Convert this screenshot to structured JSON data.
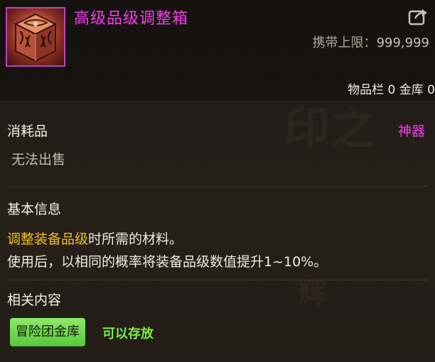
{
  "item": {
    "name": "高级品级调整箱",
    "carry_limit_label": "携带上限：",
    "carry_limit_value": "999,999",
    "storage_text": "物品栏 0 金库 0",
    "category": "消耗品",
    "rarity": "神器",
    "sell_status": "无法出售"
  },
  "basic_info": {
    "title": "基本信息",
    "line1_highlight": "调整装备品级",
    "line1_rest": "时所需的材料。",
    "line2": "使用后，以相同的概率将装备品级数值提升1~10%。"
  },
  "related": {
    "title": "相关内容",
    "tag_label": "冒险团金库",
    "tag_note": "可以存放"
  },
  "colors": {
    "rarity": "#f040e8",
    "highlight": "#f0c020",
    "tag_bg": "#6ad84a",
    "tag_note": "#7cf040"
  },
  "icons": {
    "item": "ornate-box-icon",
    "share": "share-icon"
  }
}
